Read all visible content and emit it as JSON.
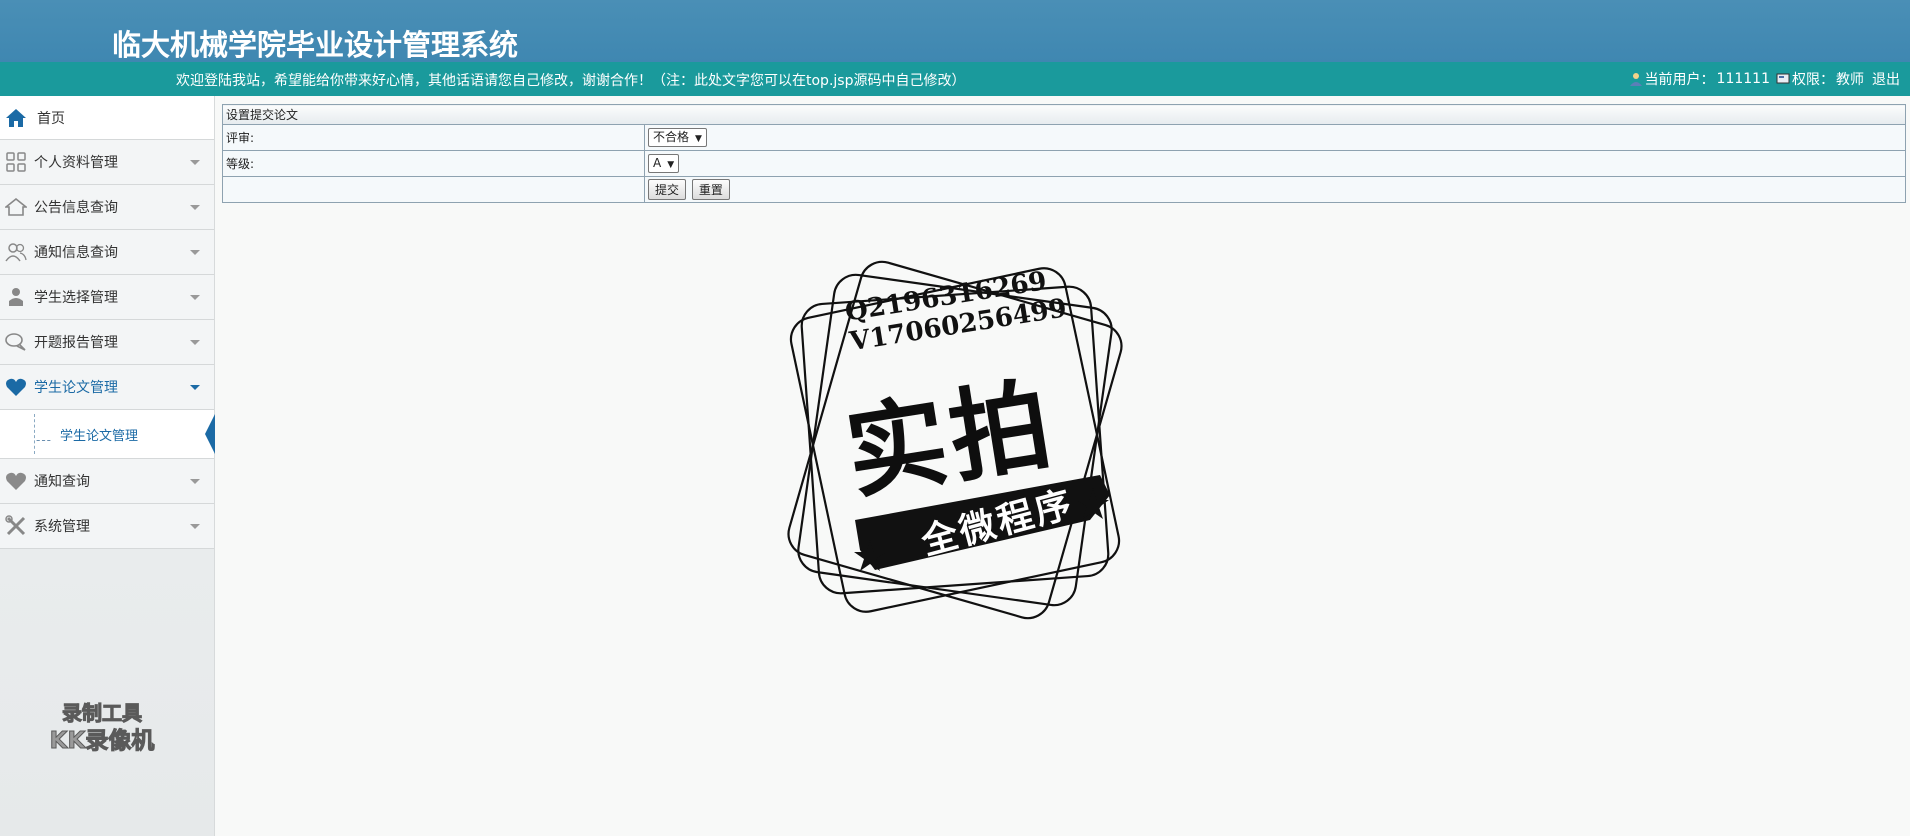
{
  "header": {
    "title": "临大机械学院毕业设计管理系统",
    "welcome": "欢迎登陆我站，希望能给你带来好心情，其他话语请您自己修改，谢谢合作！（注：此处文字您可以在top.jsp源码中自己修改）",
    "current_user_label": "当前用户：",
    "current_user": "111111",
    "role_label": "权限：",
    "role": "教师",
    "logout": "退出"
  },
  "sidebar": {
    "items": [
      {
        "label": "首页",
        "icon": "home-icon"
      },
      {
        "label": "个人资料管理",
        "icon": "grid-icon"
      },
      {
        "label": "公告信息查询",
        "icon": "house-icon"
      },
      {
        "label": "通知信息查询",
        "icon": "users-icon"
      },
      {
        "label": "学生选择管理",
        "icon": "person-icon"
      },
      {
        "label": "开题报告管理",
        "icon": "chat-icon"
      },
      {
        "label": "学生论文管理",
        "icon": "heart-icon"
      },
      {
        "label": "通知查询",
        "icon": "heart-icon"
      },
      {
        "label": "系统管理",
        "icon": "tools-icon"
      }
    ],
    "sub_item": {
      "dash": "---",
      "label": "学生论文管理"
    },
    "recorder_logo": [
      "录制工具",
      "KK录像机"
    ]
  },
  "form": {
    "header": "设置提交论文",
    "review_label": "评审:",
    "review_value": "不合格",
    "grade_label": "等级:",
    "grade_value": "A",
    "submit_label": "提交",
    "reset_label": "重置"
  },
  "watermark": {
    "line1": "Q2196316269",
    "line2": "V17060256499",
    "big": "实拍",
    "ribbon": "全微程序"
  },
  "colors": {
    "banner": "#4a8fb6",
    "infobar": "#1a9a9c",
    "accent": "#1b6aa5"
  }
}
